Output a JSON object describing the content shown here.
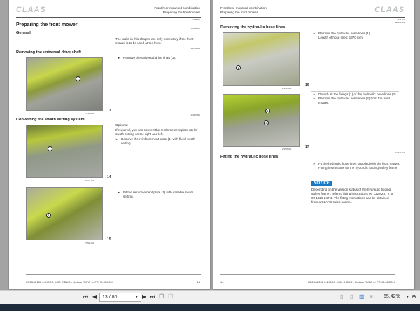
{
  "left_page": {
    "logo": "CLAAS",
    "header_line1": "Front/rear-mounted combination",
    "header_line2": "Preparing the front mower",
    "codes": [
      "2728-001",
      "221006-001",
      "248783-001",
      "276598-001",
      "221037-001",
      "276411-001",
      "276594-001"
    ],
    "title": "Preparing the front mower",
    "general_heading": "General",
    "general_text": "The tasks in this chapter are only necessary if the front mower is to be used at the front.",
    "section1_heading": "Removing the universal drive shaft",
    "section1_step": "Remove the universal drive shaft (1).",
    "fig13": "13",
    "section2_heading": "Converting the swath setting system",
    "optional": "Optional:",
    "optional_text": "If required, you can convert the reinforcement plate (1) for swath setting on the right and left.",
    "section2_step1": "Remove the reinforcement plate (1) with fixed swath setting.",
    "fig14": "14",
    "section2_step2": "Fit the reinforcement plate (1) with variable swath setting.",
    "fig15": "15",
    "footer_doc": "00 2348 208 0-DISCO 9400 C DUO - Umbau RÜFA <> FRHE-05/2019",
    "footer_page": "13",
    "callout": "1"
  },
  "right_page": {
    "logo": "CLAAS",
    "header_line1": "Front/rear-mounted combination",
    "header_line2": "Preparing the front mower",
    "codes": [
      "2728-001",
      "226163-001",
      "271665-001",
      "271676-001",
      "221047-001"
    ],
    "section1_heading": "Removing the hydraulic hose lines",
    "step1": "Remove the hydraulic hose lines (1).",
    "step1_note": "Length of hose lines: 1370 mm",
    "fig16": "16",
    "step2": "Detach all the fixings (1) of the hydraulic hose lines (2).",
    "step3": "Remove the hydraulic hose lines (2) from the front mower.",
    "fig17": "17",
    "section2_heading": "Fitting the hydraulic hose lines",
    "step4": "Fit the hydraulic hose lines supplied with the front mower.",
    "step4_ref": "Fitting instructions for the hydraulic folding safety frame\"",
    "notice_label": "NOTICE",
    "notice_text": "Depending on the version status of the hydraulic folding safety frame\", refer to fitting instructions 00 1329 247 2 or 00 1329 247 1. The fitting instructions can be obtained from a CLAAS sales partner.",
    "footer_doc": "00 2348 208 0-DISCO 9400 C DUO - Umbau RÜFA <> FRHE-05/2019",
    "footer_page": "14",
    "callout1": "1",
    "callout2": "2"
  },
  "toolbar": {
    "page_value": "13 / 80",
    "zoom": "65.42%"
  }
}
